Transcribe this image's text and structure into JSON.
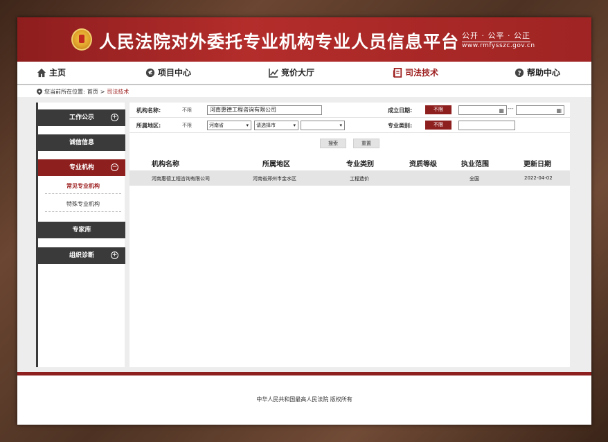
{
  "header": {
    "site_title": "人民法院对外委托专业机构专业人员信息平台",
    "slogan": "公开 · 公平 · 公正",
    "domain": "www.rmfysszc.gov.cn"
  },
  "nav": {
    "items": [
      {
        "label": "主页",
        "icon": "home-icon"
      },
      {
        "label": "项目中心",
        "icon": "gavel-icon"
      },
      {
        "label": "竞价大厅",
        "icon": "chart-icon"
      },
      {
        "label": "司法技术",
        "icon": "document-icon"
      },
      {
        "label": "帮助中心",
        "icon": "help-icon"
      }
    ],
    "active_index": 3
  },
  "breadcrumb": {
    "prefix": "您当前所在位置:",
    "home": "首页",
    "separator": ">",
    "current": "司法技术"
  },
  "sidebar": {
    "sections": [
      {
        "label": "工作公示",
        "symbol": "+"
      },
      {
        "label": "诚信信息",
        "symbol": ""
      },
      {
        "label": "专业机构",
        "symbol": "−"
      },
      {
        "label": "专家库",
        "symbol": ""
      },
      {
        "label": "组织诊断",
        "symbol": "+"
      }
    ],
    "sub_items": [
      "常见专业机构",
      "特殊专业机构"
    ]
  },
  "filters": {
    "org_name_label": "机构名称:",
    "org_name_nolimit": "不限",
    "org_name_value": "河南惠德工程咨询有限公司",
    "founded_label": "成立日期:",
    "founded_tag": "不限",
    "date_separator": "---",
    "region_label": "所属地区:",
    "region_nolimit": "不限",
    "province": "河南省",
    "city": "请选择市",
    "district": "",
    "category_label": "专业类别:",
    "category_tag": "不限",
    "search_button": "搜索",
    "reset_button": "重置"
  },
  "table": {
    "columns": [
      "机构名称",
      "所属地区",
      "专业类别",
      "资质等级",
      "执业范围",
      "更新日期"
    ],
    "rows": [
      [
        "河南惠德工程咨询有限公司",
        "河南省郑州市金水区",
        "工程造价",
        "",
        "全国",
        "2022-04-02"
      ]
    ]
  },
  "footer": {
    "copyright": "中华人民共和国最高人民法院 版权所有"
  },
  "colors": {
    "brand_red": "#8e1f1f",
    "banner_red": "#b32d2b",
    "dark": "#3a3a3a"
  }
}
